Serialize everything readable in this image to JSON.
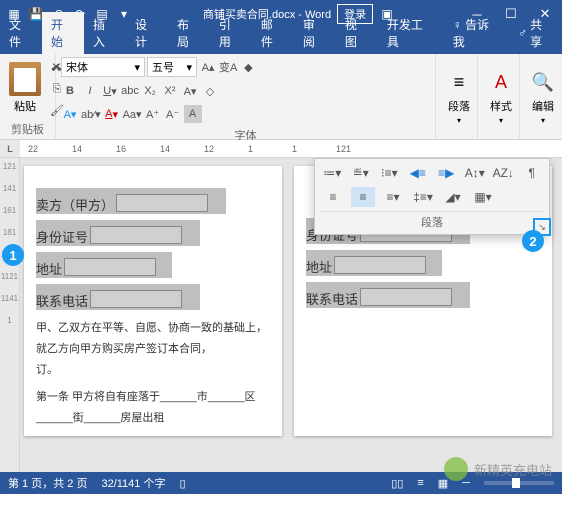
{
  "titlebar": {
    "doc_name": "商铺买卖合同.docx - Word",
    "login": "登录"
  },
  "tabs": {
    "file": "文件",
    "home": "开始",
    "insert": "插入",
    "design": "设计",
    "layout": "布局",
    "references": "引用",
    "mailings": "邮件",
    "review": "审阅",
    "view": "视图",
    "developer": "开发工具",
    "tellme": "告诉我",
    "share": "共享"
  },
  "ribbon": {
    "paste": "粘贴",
    "clipboard": "剪贴板",
    "font_name": "宋体",
    "font_size": "五号",
    "font_group": "字体",
    "paragraph": "段落",
    "styles": "样式",
    "editing": "编辑"
  },
  "ruler": [
    "22",
    "14",
    "16",
    "14",
    "12",
    "1",
    "1",
    "121"
  ],
  "vruler": [
    "121",
    "141",
    "161",
    "181",
    "1101",
    "1121",
    "1141",
    "1"
  ],
  "doc": {
    "seller": "卖方（甲方）",
    "id_no": "身份证号",
    "address": "地址",
    "phone": "联系电话",
    "para1": "甲、乙双方在平等、自愿、协商一致的基础上，就乙方向甲方购买房产签订本合同，",
    "para1b": "订。",
    "para2_pre": "第一条  甲方将自有座落于______市______区______街______房屋出租"
  },
  "popup": {
    "label": "段落"
  },
  "callouts": {
    "c1": "1",
    "c2": "2"
  },
  "status": {
    "page": "第 1 页，共 2 页",
    "words": "32/1141 个字"
  },
  "watermark": "新精英充电站"
}
